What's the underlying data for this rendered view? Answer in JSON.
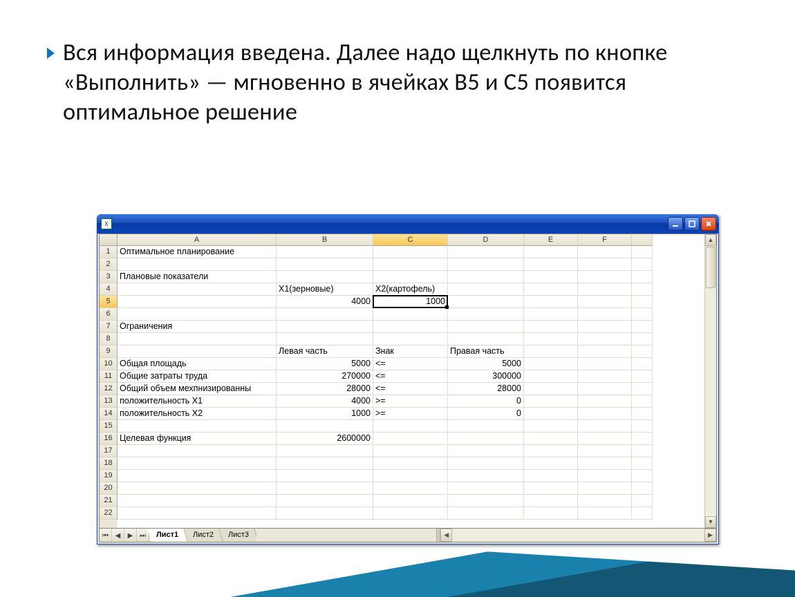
{
  "bullet_text": "Вся информация введена. Далее надо щелкнуть по кнопке «Выполнить» — мгновенно в ячейках B5 и C5 появится оптимальное решение",
  "window": {
    "title": "",
    "app_icon": "X"
  },
  "columns": [
    "A",
    "B",
    "C",
    "D",
    "E",
    "F",
    ""
  ],
  "selected_column": "C",
  "selected_row": "5",
  "rows_visible": 22,
  "tabs": {
    "t1": "Лист1",
    "t2": "Лист2",
    "t3": "Лист3"
  },
  "cells": {
    "r1": {
      "A": "Оптимальное планирование"
    },
    "r3": {
      "A": "Плановые показатели"
    },
    "r4": {
      "B": "X1(зерновые)",
      "C": "X2(картофель)"
    },
    "r5": {
      "B": "4000",
      "C": "1000"
    },
    "r7": {
      "A": "Ограничения"
    },
    "r9": {
      "B": "Левая часть",
      "C": "Знак",
      "D": "Правая часть"
    },
    "r10": {
      "A": "Общая площадь",
      "B": "5000",
      "C": "<=",
      "D": "5000"
    },
    "r11": {
      "A": "Общие затраты труда",
      "B": "270000",
      "C": "<=",
      "D": "300000"
    },
    "r12": {
      "A": "Общий объем мехпнизированны",
      "B": "28000",
      "C": "<=",
      "D": "28000"
    },
    "r13": {
      "A": "положительность X1",
      "B": "4000",
      "C": ">=",
      "D": "0"
    },
    "r14": {
      "A": "положительность X2",
      "B": "1000",
      "C": ">=",
      "D": "0"
    },
    "r16": {
      "A": "Целевая функция",
      "B": "2600000"
    }
  }
}
